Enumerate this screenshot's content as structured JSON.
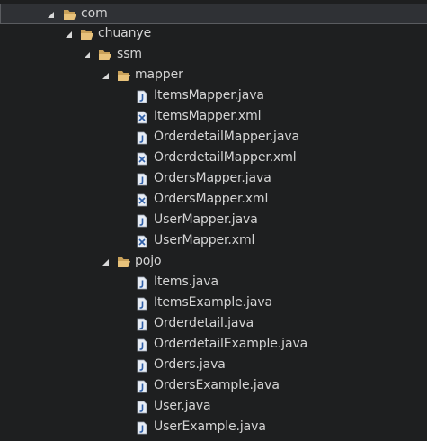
{
  "colors": {
    "background": "#1e1f20",
    "selection": "#2f3135",
    "text": "#d4d4d4",
    "folder": "#e8c27b",
    "java_icon": "#e8edf5",
    "xml_icon": "#e8edf5"
  },
  "tree": {
    "com": {
      "label": "com",
      "icon": "open-folder-icon",
      "expanded": true,
      "selected": true
    },
    "chuanye": {
      "label": "chuanye",
      "icon": "open-folder-icon",
      "expanded": true
    },
    "ssm": {
      "label": "ssm",
      "icon": "open-folder-icon",
      "expanded": true
    },
    "mapper": {
      "label": "mapper",
      "icon": "open-folder-icon",
      "expanded": true,
      "files": [
        {
          "label": "ItemsMapper.java",
          "icon": "java-file-icon"
        },
        {
          "label": "ItemsMapper.xml",
          "icon": "xml-file-icon"
        },
        {
          "label": "OrderdetailMapper.java",
          "icon": "java-file-icon"
        },
        {
          "label": "OrderdetailMapper.xml",
          "icon": "xml-file-icon"
        },
        {
          "label": "OrdersMapper.java",
          "icon": "java-file-icon"
        },
        {
          "label": "OrdersMapper.xml",
          "icon": "xml-file-icon"
        },
        {
          "label": "UserMapper.java",
          "icon": "java-file-icon"
        },
        {
          "label": "UserMapper.xml",
          "icon": "xml-file-icon"
        }
      ]
    },
    "pojo": {
      "label": "pojo",
      "icon": "open-folder-icon",
      "expanded": true,
      "files": [
        {
          "label": "Items.java",
          "icon": "java-file-icon"
        },
        {
          "label": "ItemsExample.java",
          "icon": "java-file-icon"
        },
        {
          "label": "Orderdetail.java",
          "icon": "java-file-icon"
        },
        {
          "label": "OrderdetailExample.java",
          "icon": "java-file-icon"
        },
        {
          "label": "Orders.java",
          "icon": "java-file-icon"
        },
        {
          "label": "OrdersExample.java",
          "icon": "java-file-icon"
        },
        {
          "label": "User.java",
          "icon": "java-file-icon"
        },
        {
          "label": "UserExample.java",
          "icon": "java-file-icon"
        }
      ]
    }
  }
}
